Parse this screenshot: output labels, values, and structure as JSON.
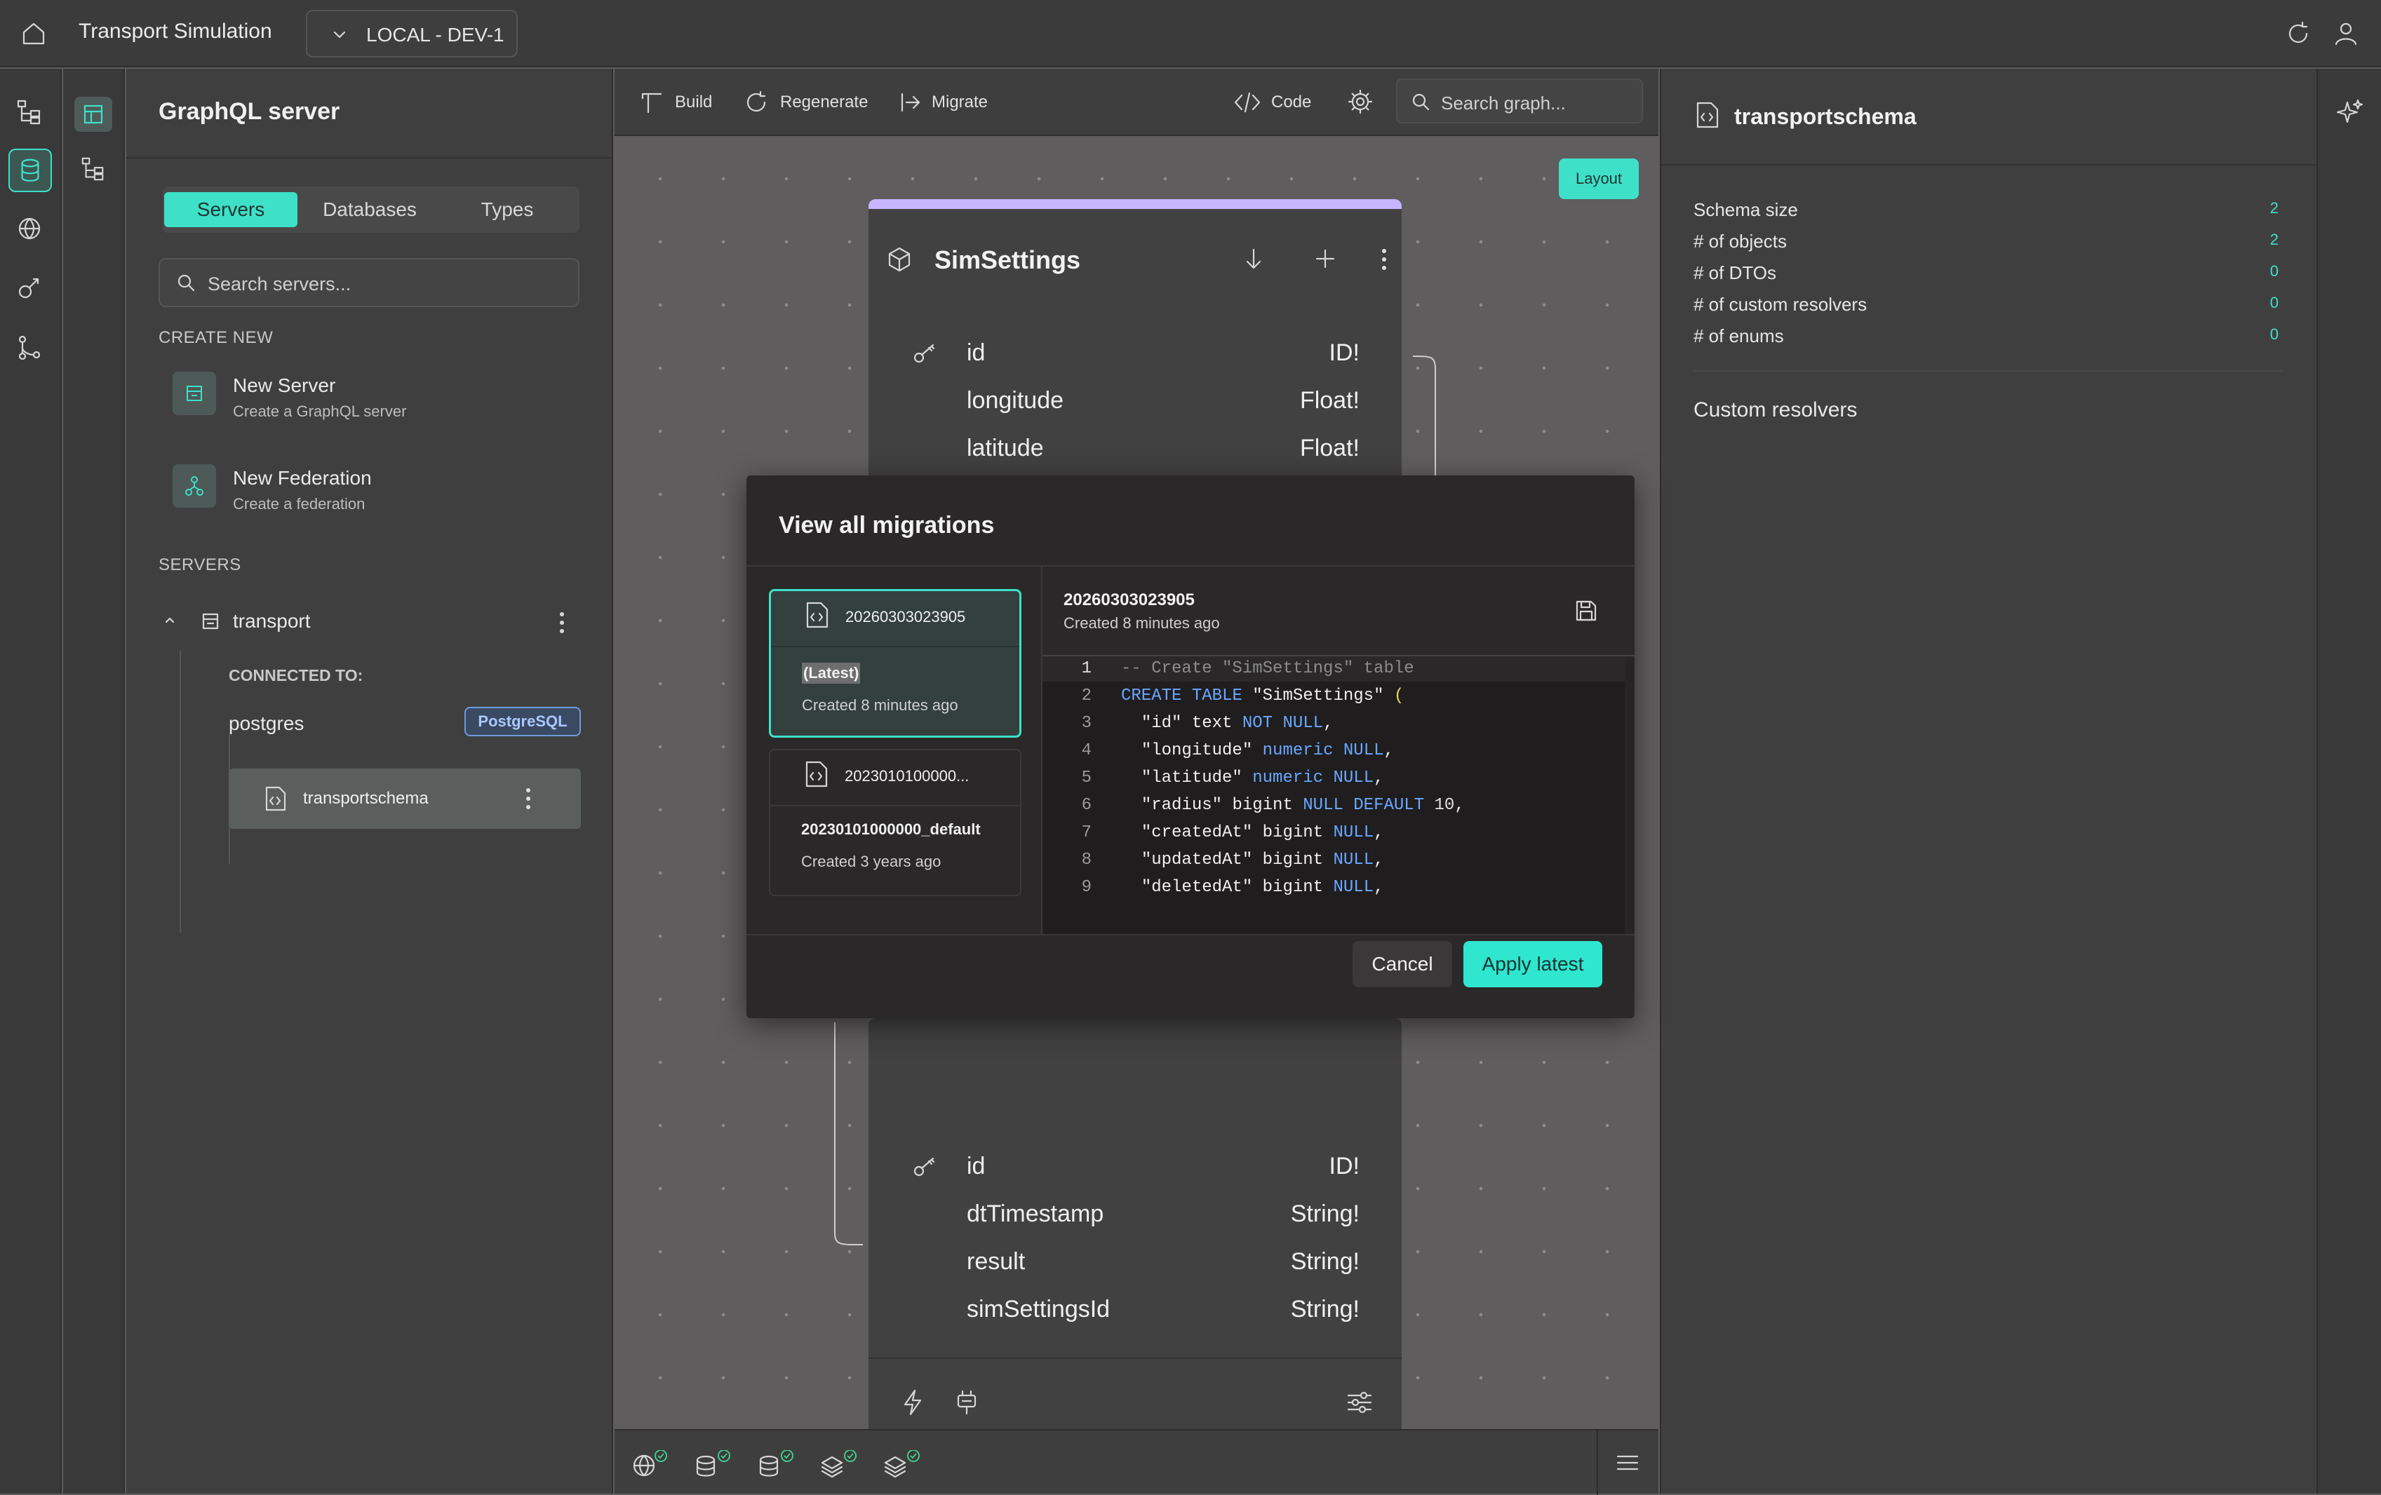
{
  "app": {
    "title": "Transport Simulation",
    "environment": "LOCAL - DEV-1"
  },
  "left_panel": {
    "title": "GraphQL server",
    "tabs": [
      {
        "label": "Servers",
        "active": true
      },
      {
        "label": "Databases",
        "active": false
      },
      {
        "label": "Types",
        "active": false
      }
    ],
    "search_placeholder": "Search servers...",
    "create_new_heading": "CREATE NEW",
    "create_items": [
      {
        "title": "New Server",
        "subtitle": "Create a GraphQL server"
      },
      {
        "title": "New Federation",
        "subtitle": "Create a federation"
      }
    ],
    "servers_heading": "SERVERS",
    "server": {
      "name": "transport",
      "connected_to_label": "CONNECTED TO:",
      "database": "postgres",
      "database_badge": "PostgreSQL",
      "schema": "transportschema"
    }
  },
  "toolbar": {
    "build": "Build",
    "regenerate": "Regenerate",
    "migrate": "Migrate",
    "code": "Code",
    "search_placeholder": "Search graph..."
  },
  "canvas": {
    "layout_button": "Layout",
    "node_top": {
      "title": "SimSettings",
      "fields": [
        {
          "name": "id",
          "type": "ID!"
        },
        {
          "name": "longitude",
          "type": "Float!"
        },
        {
          "name": "latitude",
          "type": "Float!"
        }
      ]
    },
    "node_bottom": {
      "fields": [
        {
          "name": "id",
          "type": "ID!"
        },
        {
          "name": "dtTimestamp",
          "type": "String!"
        },
        {
          "name": "result",
          "type": "String!"
        },
        {
          "name": "simSettingsId",
          "type": "String!"
        }
      ]
    }
  },
  "right_panel": {
    "title": "transportschema",
    "stats": [
      {
        "label": "Schema size",
        "value": "2"
      },
      {
        "label": "# of objects",
        "value": "2"
      },
      {
        "label": "# of DTOs",
        "value": "0"
      },
      {
        "label": "# of custom resolvers",
        "value": "0"
      },
      {
        "label": "# of enums",
        "value": "0"
      }
    ],
    "custom_resolvers_heading": "Custom resolvers"
  },
  "modal": {
    "title": "View all migrations",
    "migrations": [
      {
        "id": "20260303023905",
        "tag": "(Latest)",
        "created": "Created 8 minutes ago",
        "selected": true
      },
      {
        "id": "2023010100000...",
        "name": "20230101000000_default",
        "created": "Created 3 years ago",
        "selected": false
      }
    ],
    "detail": {
      "id": "20260303023905",
      "created": "Created 8 minutes ago"
    },
    "code_lines": [
      "-- Create \"SimSettings\" table",
      "CREATE TABLE \"SimSettings\" (",
      "  \"id\" text NOT NULL,",
      "  \"longitude\" numeric NULL,",
      "  \"latitude\" numeric NULL,",
      "  \"radius\" bigint NULL DEFAULT 10,",
      "  \"createdAt\" bigint NULL,",
      "  \"updatedAt\" bigint NULL,",
      "  \"deletedAt\" bigint NULL,"
    ],
    "line_numbers": [
      "1",
      "2",
      "3",
      "4",
      "5",
      "6",
      "7",
      "8",
      "9"
    ],
    "cancel": "Cancel",
    "apply": "Apply latest"
  },
  "colors": {
    "accent": "#3ee0c8",
    "keyword": "#6aa8ff",
    "node_header_bar": "#c7b6ff"
  }
}
